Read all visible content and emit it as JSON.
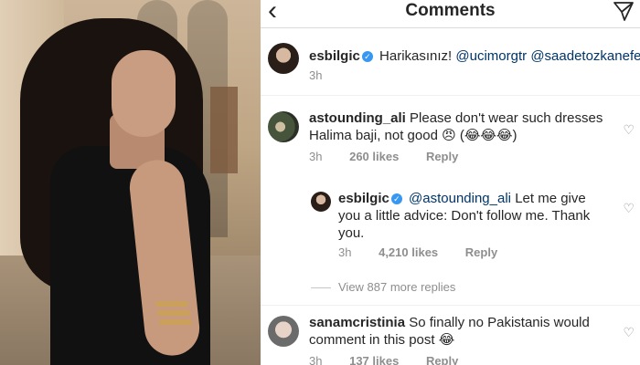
{
  "header": {
    "title": "Comments",
    "back_icon": "chevron-left-icon",
    "send_icon": "paper-plane-icon"
  },
  "comments": [
    {
      "username": "esbilgic",
      "verified": true,
      "text": "Harikasınız!",
      "mentions": [
        "@ucimorgtr",
        "@saadetozkanefe"
      ],
      "time": "3h"
    },
    {
      "username": "astounding_ali",
      "verified": false,
      "text_line1": "Please don't wear such dresses",
      "text_line2": "Halima baji, not good 😠 (😂😂😂)",
      "time": "3h",
      "likes": "260 likes",
      "reply": "Reply"
    },
    {
      "username": "esbilgic",
      "verified": true,
      "mention": "@astounding_ali",
      "text_line1": "Let me give",
      "text_line2": "you a little advice: Don't follow me. Thank",
      "text_line3": "you.",
      "time": "3h",
      "likes": "4,210 likes",
      "reply": "Reply"
    },
    {
      "username": "sanamcristinia",
      "verified": false,
      "text_line1": "So finally no Pakistanis would",
      "text_line2": "comment in this post 😂",
      "time": "3h",
      "likes": "137 likes",
      "reply": "Reply"
    }
  ],
  "view_more_replies": "View 887 more replies",
  "colors": {
    "text": "#262626",
    "meta": "#8e8e8e",
    "mention": "#003569",
    "verified": "#3897f0"
  }
}
